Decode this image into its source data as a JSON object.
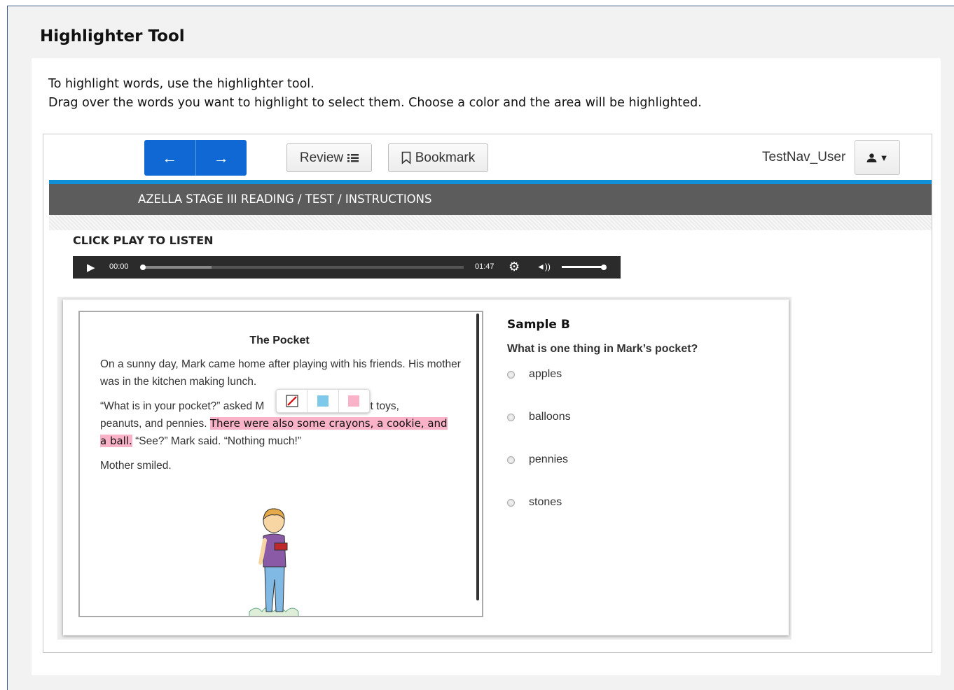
{
  "page": {
    "title": "Highlighter Tool",
    "instructions": [
      "To highlight words, use the highlighter tool.",
      "Drag over the words you want to highlight to select them. Choose a color and the area will be highlighted."
    ]
  },
  "toolbar": {
    "back_icon": "arrow-left-icon",
    "next_icon": "arrow-right-icon",
    "review_label": "Review",
    "bookmark_label": "Bookmark",
    "username": "TestNav_User",
    "accent": "#0f68d3"
  },
  "breadcrumb": "AZELLA STAGE III READING / TEST / INSTRUCTIONS",
  "audio": {
    "heading": "CLICK PLAY TO LISTEN",
    "current_time": "00:00",
    "duration": "01:47",
    "progress": 0,
    "volume": 1.0
  },
  "passage": {
    "title": "The Pocket",
    "p1": "On a sunny day, Mark came home after playing with his friends. His mother was in the kitchen making lunch.",
    "p2_before": "“What is in your pocket?” asked M",
    "p2_hidden_end": "out toys,",
    "p2_line2": "peanuts, and pennies.",
    "p2_highlight_a": "There were also some crayons, a cookie, and",
    "p2_highlight_b": "a ball.",
    "p2_after": "“See?” Mark said. “Nothing much!”",
    "p3": "Mother smiled.",
    "highlight_color": "#f9b2c8",
    "highlighter_options": [
      "clear-highlight-icon",
      "blue-highlight-swatch",
      "pink-highlight-swatch"
    ]
  },
  "question": {
    "label": "Sample B",
    "text": "What is one thing in Mark’s pocket?",
    "options": [
      "apples",
      "balloons",
      "pennies",
      "stones"
    ]
  }
}
